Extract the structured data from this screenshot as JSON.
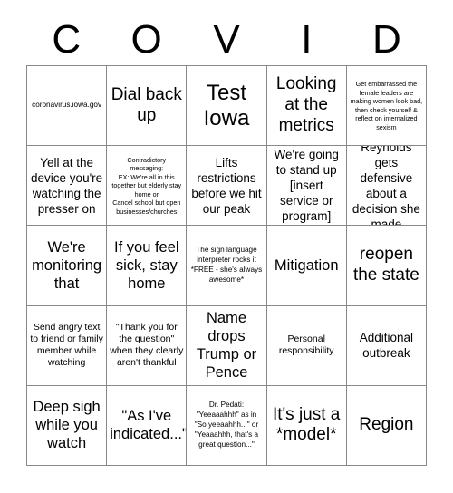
{
  "header": {
    "letters": [
      "C",
      "O",
      "V",
      "I",
      "D"
    ]
  },
  "grid": {
    "columns": 5,
    "rows": 5,
    "cells": [
      {
        "text": "coronavirus.iowa.gov",
        "size": "xs"
      },
      {
        "text": "Dial back up",
        "size": "xl"
      },
      {
        "text": "Test Iowa",
        "size": "xxl"
      },
      {
        "text": "Looking at the metrics",
        "size": "xl"
      },
      {
        "text": "Get embarrassed the female leaders are making women look bad, then check yourself & reflect on internalized sexism",
        "size": "xxs"
      },
      {
        "text": "Yell at the device you're watching the presser on",
        "size": "m"
      },
      {
        "text": "Contradictory messaging:\nEX: We're all in this together but elderly stay home or\nCancel school but open businesses/churches",
        "size": "xxs"
      },
      {
        "text": "Lifts restrictions before we hit our peak",
        "size": "m"
      },
      {
        "text": "We're going to stand up [insert service or program]",
        "size": "m"
      },
      {
        "text": "Reynolds gets defensive about a decision she made",
        "size": "m"
      },
      {
        "text": "We're monitoring that",
        "size": "l"
      },
      {
        "text": "If you feel sick, stay home",
        "size": "l"
      },
      {
        "text": "The sign language interpreter rocks it *FREE - she's always awesome*",
        "size": "xs"
      },
      {
        "text": "Mitigation",
        "size": "l"
      },
      {
        "text": "reopen the state",
        "size": "xl"
      },
      {
        "text": "Send angry text to friend or family member while watching",
        "size": "s"
      },
      {
        "text": "\"Thank you for the question\" when they clearly aren't thankful",
        "size": "s"
      },
      {
        "text": "Name drops Trump or Pence",
        "size": "l"
      },
      {
        "text": "Personal responsibility",
        "size": "s"
      },
      {
        "text": "Additional outbreak",
        "size": "m"
      },
      {
        "text": "Deep sigh while you watch",
        "size": "l"
      },
      {
        "text": "\"As I've indicated...\"",
        "size": "l"
      },
      {
        "text": "Dr. Pedati: \"Yeeaaahhh\" as in \"So yeeaahhh...\" or \"Yeaaahhh, that's a great question...\"",
        "size": "xs"
      },
      {
        "text": "It's just a *model*",
        "size": "xl"
      },
      {
        "text": "Region",
        "size": "xl"
      }
    ]
  }
}
